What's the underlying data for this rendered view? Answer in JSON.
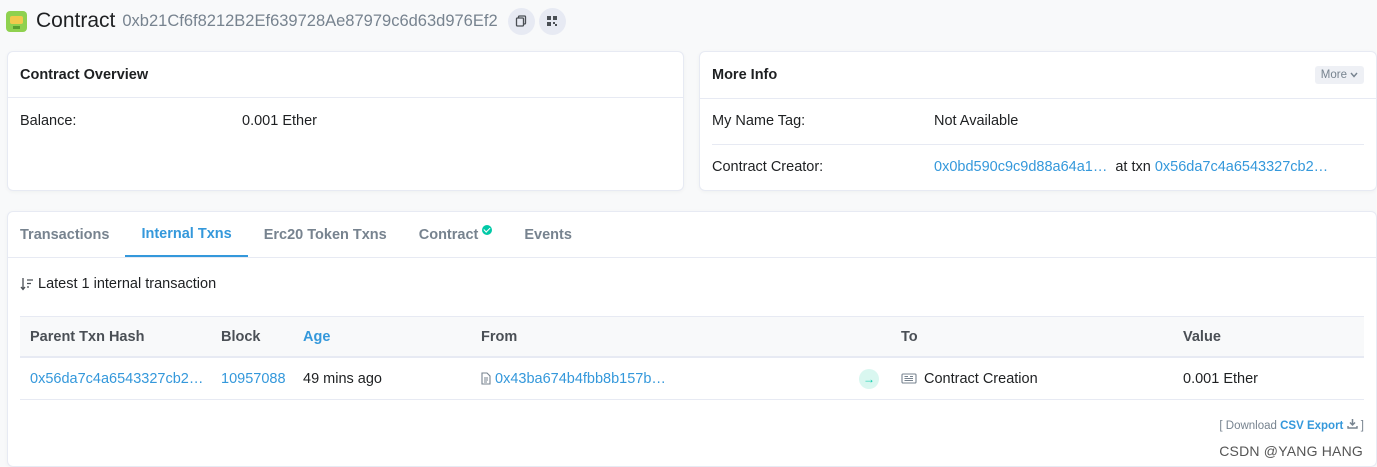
{
  "header": {
    "title": "Contract",
    "address": "0xb21Cf6f8212B2Ef639728Ae87979c6d63d976Ef2"
  },
  "overview": {
    "title": "Contract Overview",
    "balance_label": "Balance:",
    "balance_value": "0.001 Ether"
  },
  "more_info": {
    "title": "More Info",
    "more_button": "More",
    "name_tag_label": "My Name Tag:",
    "name_tag_value": "Not Available",
    "creator_label": "Contract Creator:",
    "creator_address": "0x0bd590c9c9d88a64a1…",
    "at_txn": "at txn",
    "creator_txn": "0x56da7c4a6543327cb2…"
  },
  "tabs": [
    {
      "label": "Transactions"
    },
    {
      "label": "Internal Txns"
    },
    {
      "label": "Erc20 Token Txns"
    },
    {
      "label": "Contract"
    },
    {
      "label": "Events"
    }
  ],
  "active_tab": "Internal Txns",
  "summary": "Latest 1 internal transaction",
  "table": {
    "headers": [
      "Parent Txn Hash",
      "Block",
      "Age",
      "From",
      "To",
      "Value"
    ],
    "rows": [
      {
        "parent_txn": "0x56da7c4a6543327cb2…",
        "block": "10957088",
        "age": "49 mins ago",
        "from": "0x43ba674b4fbb8b157b…",
        "to": "Contract Creation",
        "value": "0.001 Ether"
      }
    ]
  },
  "export": {
    "prefix": "[ Download",
    "link": "CSV Export",
    "suffix": "]"
  },
  "watermark": "CSDN @YANG HANG",
  "colors": {
    "accent": "#3498db",
    "success": "#00c9a7",
    "muted": "#77838f"
  }
}
